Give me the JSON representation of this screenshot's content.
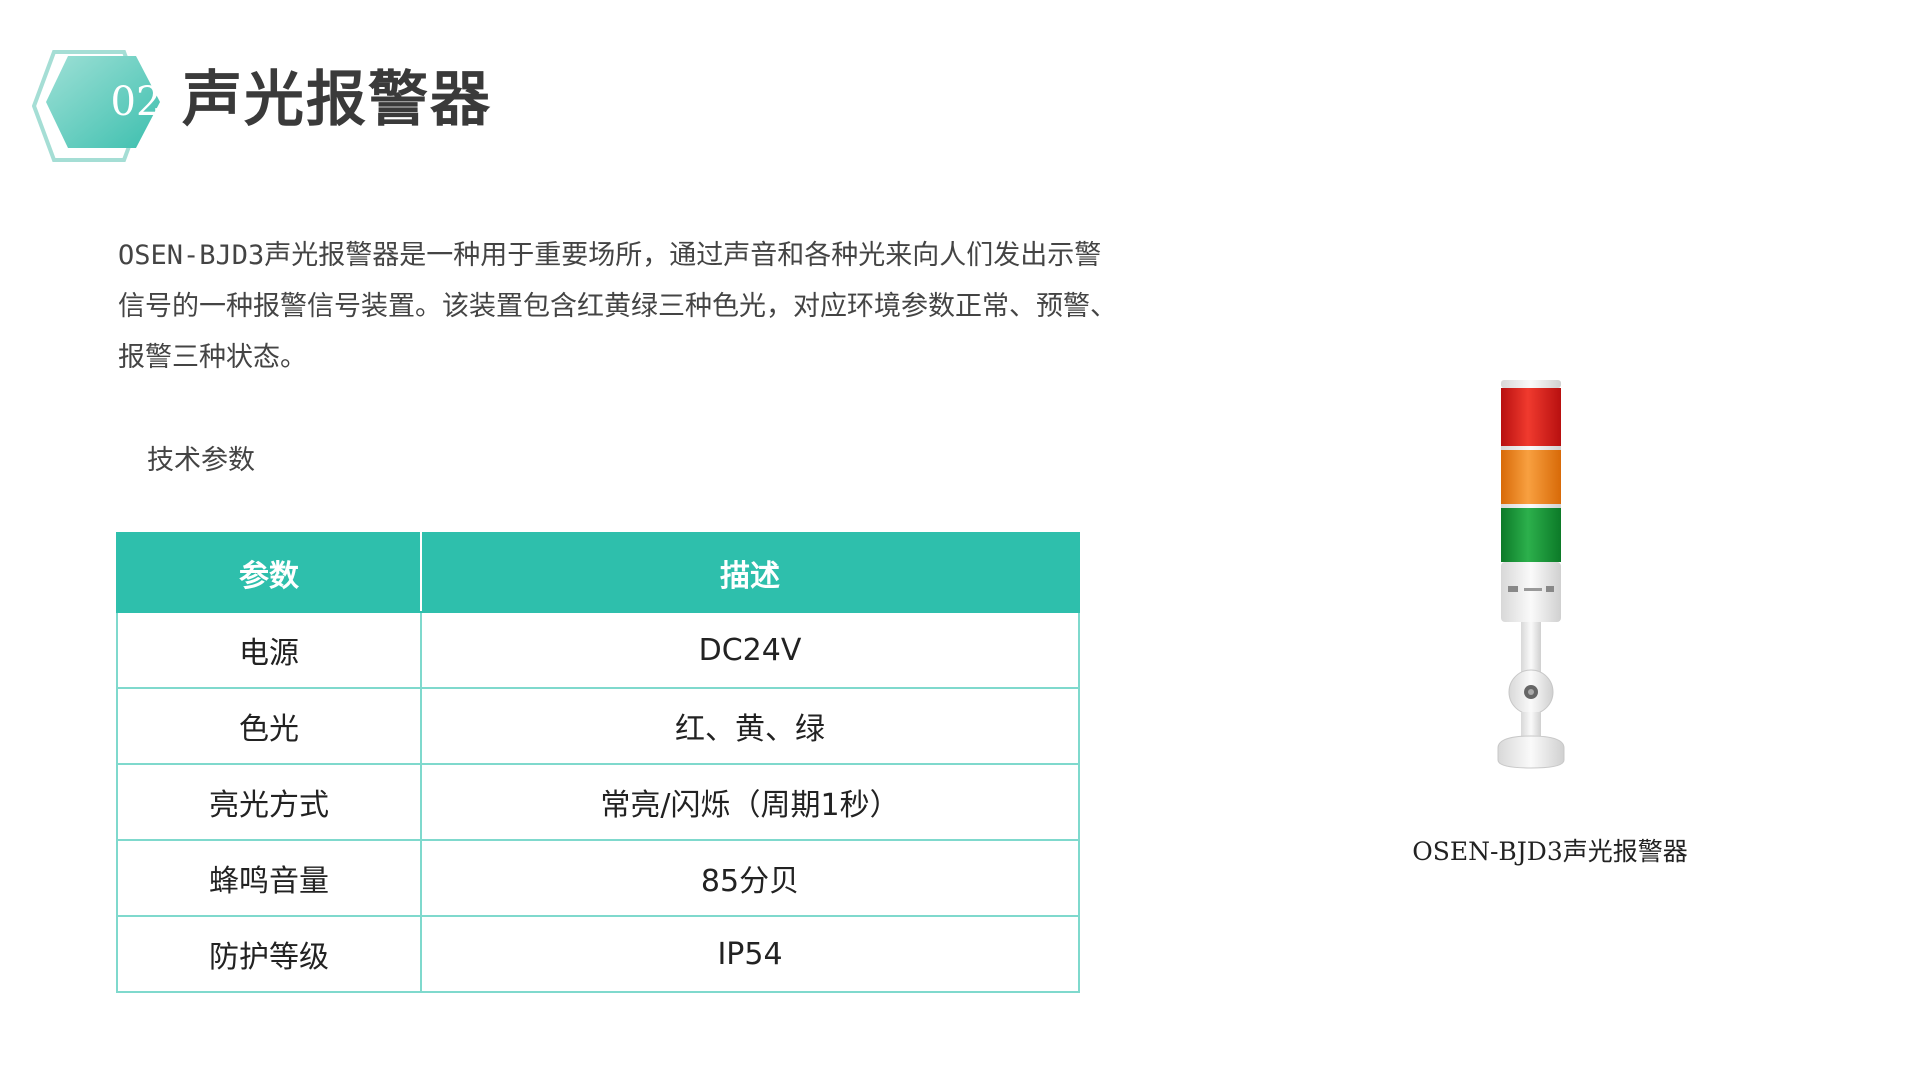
{
  "header": {
    "badge_number": "02",
    "title": "声光报警器"
  },
  "intro": {
    "text": "OSEN-BJD3声光报警器是一种用于重要场所，通过声音和各种光来向人们发出示警信号的一种报警信号装置。该装置包含红黄绿三种色光，对应环境参数正常、预警、报警三种状态。"
  },
  "spec_section": {
    "label": "技术参数",
    "table": {
      "headers": [
        "参数",
        "描述"
      ],
      "rows": [
        [
          "电源",
          "DC24V"
        ],
        [
          "色光",
          "红、黄、绿"
        ],
        [
          "亮光方式",
          "常亮/闪烁（周期1秒）"
        ],
        [
          "蜂鸣音量",
          "85分贝"
        ],
        [
          "防护等级",
          "IP54"
        ]
      ]
    }
  },
  "product": {
    "caption": "OSEN-BJD3声光报警器",
    "icon": "signal-tower-light-icon",
    "light_colors": [
      "#e02020",
      "#f08a1c",
      "#1a9a3a"
    ]
  },
  "colors": {
    "accent": "#2ebfac",
    "table_border": "#7fd9cd"
  }
}
